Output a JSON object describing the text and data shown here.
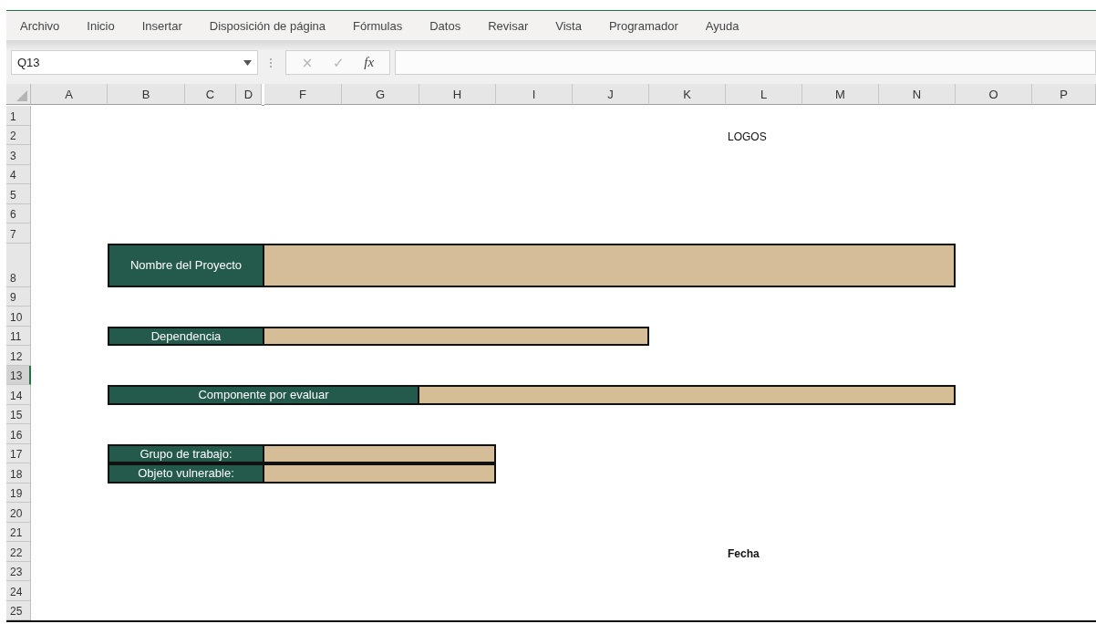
{
  "menu": [
    {
      "label": "Archivo"
    },
    {
      "label": "Inicio"
    },
    {
      "label": "Insertar"
    },
    {
      "label": "Disposición de página"
    },
    {
      "label": "Fórmulas"
    },
    {
      "label": "Datos"
    },
    {
      "label": "Revisar"
    },
    {
      "label": "Vista"
    },
    {
      "label": "Programador"
    },
    {
      "label": "Ayuda"
    }
  ],
  "name_box": "Q13",
  "formula_buttons": [
    "×",
    "✓",
    "fx"
  ],
  "columns": [
    "A",
    "B",
    "C",
    "D",
    "F",
    "G",
    "H",
    "I",
    "J",
    "K",
    "L",
    "M",
    "N",
    "O",
    "P"
  ],
  "rows": [
    {
      "label": "1",
      "selected": false
    },
    {
      "label": "2",
      "selected": false
    },
    {
      "label": "3",
      "selected": false
    },
    {
      "label": "4",
      "selected": false
    },
    {
      "label": "5",
      "selected": false
    },
    {
      "label": "6",
      "selected": false
    },
    {
      "label": "7",
      "selected": false
    },
    {
      "label": "8",
      "selected": false
    },
    {
      "label": "9",
      "selected": false
    },
    {
      "label": "10",
      "selected": false
    },
    {
      "label": "11",
      "selected": false
    },
    {
      "label": "12",
      "selected": false
    },
    {
      "label": "13",
      "selected": true
    },
    {
      "label": "14",
      "selected": false
    },
    {
      "label": "15",
      "selected": false
    },
    {
      "label": "16",
      "selected": false
    },
    {
      "label": "17",
      "selected": false
    },
    {
      "label": "18",
      "selected": false
    },
    {
      "label": "19",
      "selected": false
    },
    {
      "label": "20",
      "selected": false
    },
    {
      "label": "21",
      "selected": false
    },
    {
      "label": "22",
      "selected": false
    },
    {
      "label": "23",
      "selected": false
    },
    {
      "label": "24",
      "selected": false
    },
    {
      "label": "25",
      "selected": false
    }
  ],
  "sheet": {
    "logos": "LOGOS",
    "fields": [
      {
        "label": "Nombre del Proyecto"
      },
      {
        "label": "Dependencia"
      },
      {
        "label": "Componente por evaluar"
      },
      {
        "label": "Grupo de trabajo:"
      },
      {
        "label": "Objeto vulnerable:"
      }
    ],
    "date_label": "Fecha"
  }
}
